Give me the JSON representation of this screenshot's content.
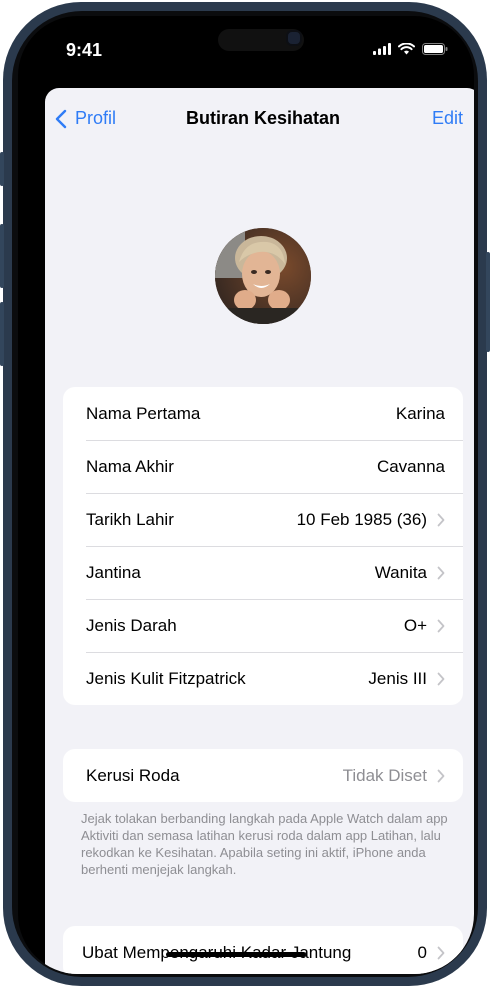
{
  "status": {
    "time": "9:41"
  },
  "nav": {
    "back_label": "Profil",
    "title": "Butiran Kesihatan",
    "edit_label": "Edit"
  },
  "details": [
    {
      "label": "Nama Pertama",
      "value": "Karina",
      "chevron": false
    },
    {
      "label": "Nama Akhir",
      "value": "Cavanna",
      "chevron": false
    },
    {
      "label": "Tarikh Lahir",
      "value": "10 Feb 1985 (36)",
      "chevron": true
    },
    {
      "label": "Jantina",
      "value": "Wanita",
      "chevron": true
    },
    {
      "label": "Jenis Darah",
      "value": "O+",
      "chevron": true
    },
    {
      "label": "Jenis Kulit Fitzpatrick",
      "value": "Jenis III",
      "chevron": true
    }
  ],
  "wheelchair": {
    "label": "Kerusi Roda",
    "value": "Tidak Diset",
    "footnote": "Jejak tolakan berbanding langkah pada Apple Watch dalam app Aktiviti dan semasa latihan kerusi roda dalam app Latihan, lalu rekodkan ke Kesihatan. Apabila seting ini aktif, iPhone anda berhenti menjejak langkah."
  },
  "medication": {
    "label": "Ubat Mempengaruhi Kadar Jantung",
    "value": "0"
  },
  "colors": {
    "accent": "#2f7cf6",
    "frame": "#2b3a4d",
    "background": "#f2f2f7"
  },
  "icons": [
    "signal-icon",
    "wifi-icon",
    "battery-icon",
    "chevron-left-icon",
    "chevron-right-icon"
  ]
}
